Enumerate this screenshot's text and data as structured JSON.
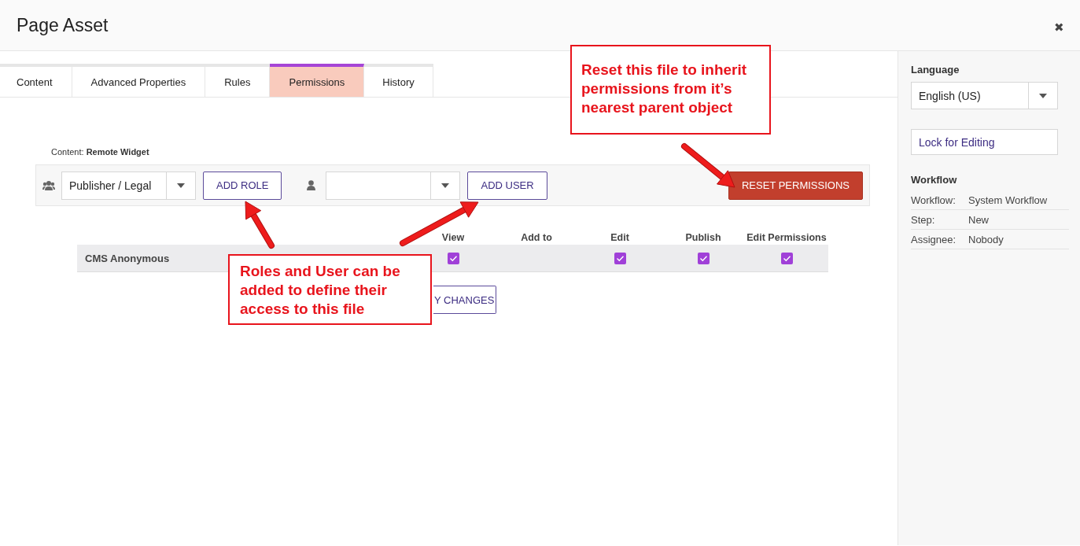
{
  "window": {
    "title": "Page Asset",
    "close": "✖"
  },
  "tabs": [
    {
      "label": "Content",
      "selected": false
    },
    {
      "label": "Advanced Properties",
      "selected": false
    },
    {
      "label": "Rules",
      "selected": false
    },
    {
      "label": "Permissions",
      "selected": true
    },
    {
      "label": "History",
      "selected": false
    }
  ],
  "content_label": {
    "label": "Content:",
    "value": "Remote Widget"
  },
  "toolbar": {
    "role_select": {
      "value": "Publisher / Legal"
    },
    "add_role": "ADD ROLE",
    "add_user": "ADD USER",
    "reset": "RESET PERMISSIONS"
  },
  "table": {
    "columns": [
      "View",
      "Add to",
      "Edit",
      "Publish",
      "Edit Permissions"
    ],
    "rows": [
      {
        "name": "CMS Anonymous",
        "permissions": [
          {
            "checked": true
          },
          {
            "checked": false
          },
          {
            "checked": true
          },
          {
            "checked": true
          },
          {
            "checked": true
          }
        ]
      }
    ]
  },
  "apply_button": "Y CHANGES",
  "sidebar": {
    "language_label": "Language",
    "language": "English (US)",
    "lock_button": "Lock for Editing",
    "workflow_heading": "Workflow",
    "workflow": [
      {
        "label": "Workflow:",
        "value": "System Workflow"
      },
      {
        "label": "Step:",
        "value": "New"
      },
      {
        "label": "Assignee:",
        "value": "Nobody"
      }
    ]
  },
  "annotations": [
    {
      "text": "Reset this file to inherit permissions from it’s nearest parent object"
    },
    {
      "text": "Roles and User can be added to define their access to this file"
    }
  ]
}
